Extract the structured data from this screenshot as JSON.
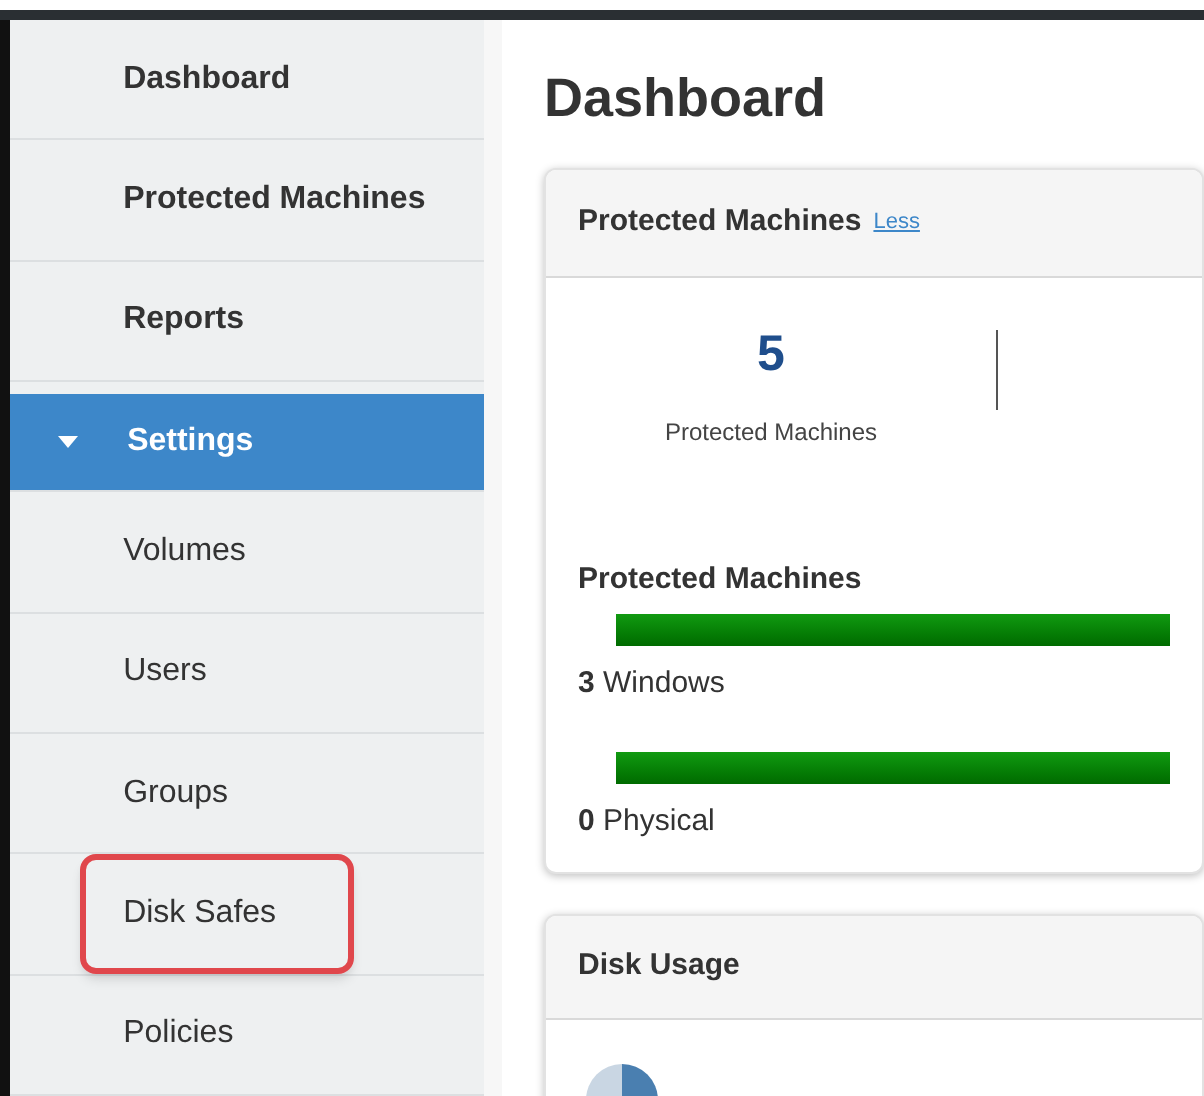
{
  "sidebar": {
    "items": [
      {
        "label": "Dashboard",
        "selected": false,
        "highlighted": false
      },
      {
        "label": "Protected Machines",
        "selected": false,
        "highlighted": false
      },
      {
        "label": "Reports",
        "selected": false,
        "highlighted": false
      },
      {
        "label": "Settings",
        "selected": true,
        "highlighted": false,
        "expanded": true,
        "children": [
          {
            "label": "Volumes",
            "selected": false,
            "highlighted": false
          },
          {
            "label": "Users",
            "selected": false,
            "highlighted": false
          },
          {
            "label": "Groups",
            "selected": false,
            "highlighted": false
          },
          {
            "label": "Disk Safes",
            "selected": false,
            "highlighted": true
          },
          {
            "label": "Policies",
            "selected": false,
            "highlighted": false
          }
        ]
      }
    ]
  },
  "page": {
    "title": "Dashboard"
  },
  "cards": [
    {
      "kind": "machines",
      "title": "Protected Machines",
      "link": "Less",
      "count": "5",
      "count_label": "Protected Machines",
      "subtitle": "Protected Machines",
      "rows": [
        {
          "value": "3",
          "label": "Windows"
        },
        {
          "value": "0",
          "label": "Physical"
        }
      ]
    },
    {
      "kind": "disk",
      "title": "Disk Usage"
    }
  ]
}
